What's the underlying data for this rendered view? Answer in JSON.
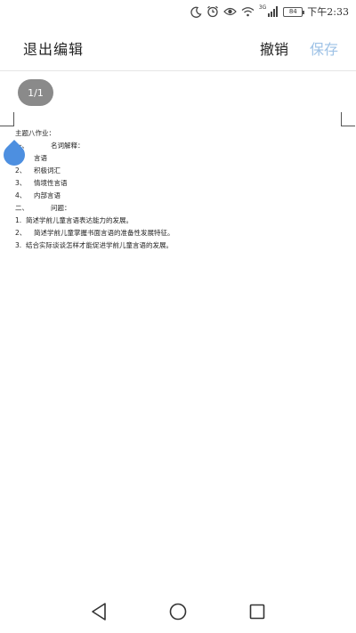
{
  "status_bar": {
    "network": "3G",
    "battery": "84",
    "time": "下午2:33",
    "icons": [
      "moon-icon",
      "alarm-icon",
      "eye-icon",
      "wifi-icon",
      "signal-icon",
      "battery-icon"
    ]
  },
  "header": {
    "exit_label": "退出编辑",
    "undo_label": "撤销",
    "save_label": "保存",
    "save_color": "#9ec2e6"
  },
  "page_indicator": "1/1",
  "document": {
    "title": "主题八作业：",
    "section1": {
      "num": "一、",
      "label": "名词解释："
    },
    "items1": [
      {
        "num": "1、",
        "text": "言语"
      },
      {
        "num": "2、",
        "text": "积极词汇"
      },
      {
        "num": "3、",
        "text": "情境性言语"
      },
      {
        "num": "4、",
        "text": "内部言语"
      }
    ],
    "section2": {
      "num": "二、",
      "label": "问题："
    },
    "items2": [
      {
        "num": "1.",
        "text": "简述学前儿童言语表达能力的发展。"
      },
      {
        "num": "2、",
        "text": "简述学前儿童掌握书面言语的准备性发展特征。"
      },
      {
        "num": "3.",
        "text": "结合实际谈谈怎样才能促进学前儿童言语的发展。"
      }
    ]
  },
  "accent_color": "#4d8fe0",
  "nav": {
    "icons": [
      "back-icon",
      "home-icon",
      "recent-apps-icon"
    ]
  }
}
